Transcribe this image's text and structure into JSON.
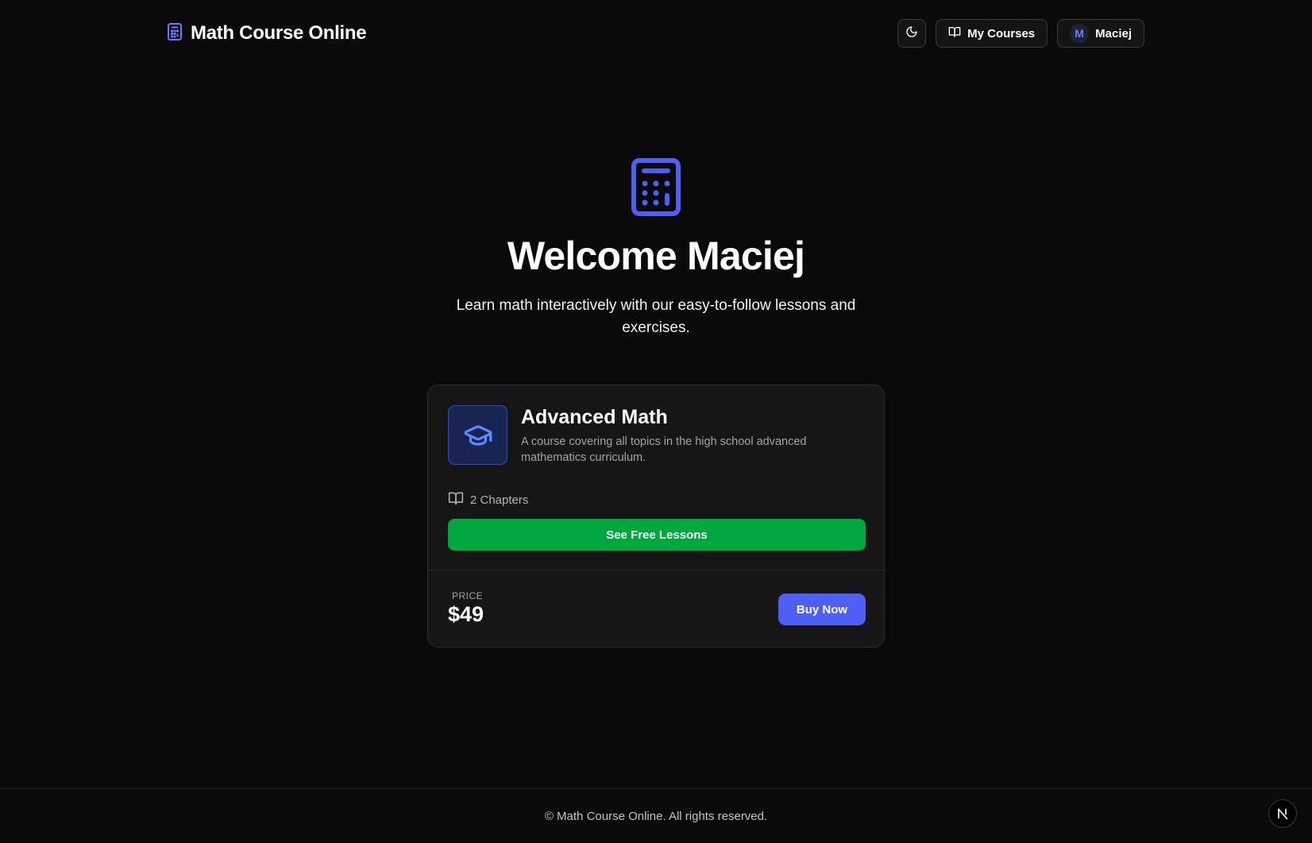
{
  "header": {
    "brand_icon": "calculator-icon",
    "title": "Math Course Online",
    "theme_toggle_icon": "moon-icon",
    "my_courses": {
      "icon": "book-open-icon",
      "label": "My Courses"
    },
    "user": {
      "avatar_initial": "M",
      "name": "Maciej"
    }
  },
  "hero": {
    "icon": "calculator-icon",
    "title": "Welcome Maciej",
    "subtitle": "Learn math interactively with our easy-to-follow lessons and exercises."
  },
  "course_card": {
    "icon": "graduation-cap-icon",
    "title": "Advanced Math",
    "description": "A course covering all topics in the high school advanced mathematics curriculum.",
    "chapters_icon": "book-open-icon",
    "chapters": "2 Chapters",
    "free_lessons_button": "See Free Lessons",
    "price_label": "PRICE",
    "price": "$49",
    "buy_button": "Buy Now"
  },
  "footer": {
    "text": "© Math Course Online. All rights reserved.",
    "badge_letter": "N"
  },
  "colors": {
    "background": "#0a0a0a",
    "accent": "#4f5ff6",
    "success": "#00a63e",
    "card": "#161616"
  }
}
